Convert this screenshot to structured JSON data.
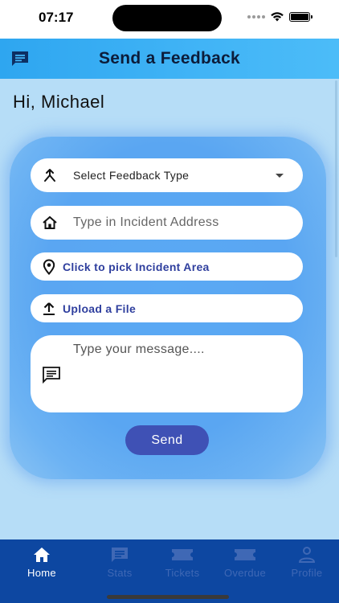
{
  "status_bar": {
    "time": "07:17"
  },
  "app_bar": {
    "title": "Send a Feedback",
    "leading_icon": "feedback-icon"
  },
  "greeting": "Hi, Michael",
  "form": {
    "feedback_type": {
      "value": "Select Feedback Type",
      "icon": "merge-arrow-icon"
    },
    "incident_address": {
      "placeholder": "Type in Incident Address",
      "icon": "house-icon"
    },
    "incident_area": {
      "label": "Click to pick Incident Area",
      "icon": "location-pin-icon"
    },
    "upload": {
      "label": "Upload a File",
      "icon": "upload-icon"
    },
    "message": {
      "placeholder": "Type your message....",
      "icon": "message-icon"
    },
    "send_label": "Send"
  },
  "bottom_nav": {
    "items": [
      {
        "label": "Home",
        "icon": "home-icon",
        "active": true
      },
      {
        "label": "Stats",
        "icon": "chart-icon",
        "active": false
      },
      {
        "label": "Tickets",
        "icon": "ticket-icon",
        "active": false
      },
      {
        "label": "Overdue",
        "icon": "ticket-icon",
        "active": false
      },
      {
        "label": "Profile",
        "icon": "person-icon",
        "active": false
      }
    ]
  },
  "colors": {
    "app_bar": "#2ea6f0",
    "background": "#b6ddf7",
    "card": "#5aa6f2",
    "accent": "#3f51b5",
    "nav": "#0d47a1",
    "nav_inactive": "#3f68b5"
  }
}
